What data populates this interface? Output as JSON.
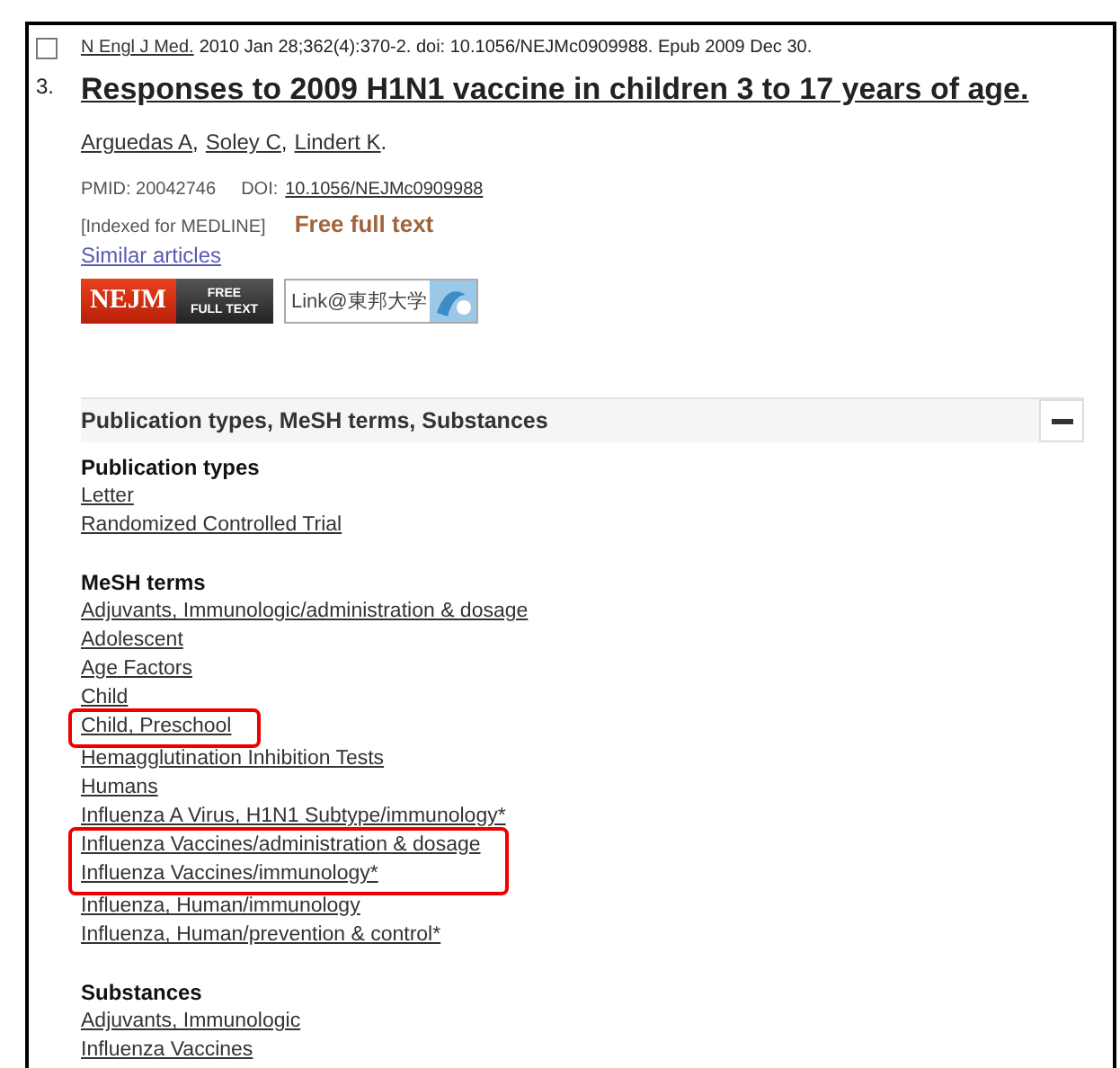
{
  "citation": {
    "checked": false,
    "number": "3.",
    "journal": "N Engl J Med.",
    "details": "2010 Jan 28;362(4):370-2. doi: 10.1056/NEJMc0909988. Epub 2009 Dec 30.",
    "title": "Responses to 2009 H1N1 vaccine in children 3 to 17 years of age.",
    "authors": [
      {
        "name": "Arguedas A",
        "separator": ","
      },
      {
        "name": "Soley C",
        "separator": ","
      },
      {
        "name": "Lindert K",
        "separator": "."
      }
    ],
    "pmid": "PMID: 20042746",
    "doi_label": "DOI:",
    "doi": "10.1056/NEJMc0909988",
    "indexed": "[Indexed for MEDLINE]",
    "free_text": "Free full text",
    "similar": "Similar articles",
    "badges": [
      {
        "kind": "nejm",
        "label": "NEJM",
        "sublabel_1": "FREE",
        "sublabel_2": "FULL TEXT"
      },
      {
        "kind": "library",
        "label": "Link@東邦大学"
      }
    ]
  },
  "section": {
    "title": "Publication types, MeSH terms, Substances",
    "expanded": true,
    "groups": [
      {
        "heading": "Publication types",
        "blocks": [
          {
            "highlighted": false,
            "items": [
              "Letter",
              "Randomized Controlled Trial"
            ]
          }
        ]
      },
      {
        "heading": "MeSH terms",
        "blocks": [
          {
            "highlighted": false,
            "items": [
              "Adjuvants, Immunologic/administration & dosage",
              "Adolescent",
              "Age Factors",
              "Child"
            ]
          },
          {
            "highlighted": true,
            "items": [
              "Child, Preschool"
            ]
          },
          {
            "highlighted": false,
            "items": [
              "Hemagglutination Inhibition Tests",
              "Humans",
              "Influenza A Virus, H1N1 Subtype/immunology*"
            ]
          },
          {
            "highlighted": true,
            "items": [
              "Influenza Vaccines/administration & dosage",
              "Influenza Vaccines/immunology*"
            ]
          },
          {
            "highlighted": false,
            "items": [
              "Influenza, Human/immunology",
              "Influenza, Human/prevention & control*"
            ]
          }
        ]
      },
      {
        "heading": "Substances",
        "blocks": [
          {
            "highlighted": false,
            "items": [
              "Adjuvants, Immunologic",
              "Influenza Vaccines"
            ]
          }
        ]
      }
    ]
  }
}
